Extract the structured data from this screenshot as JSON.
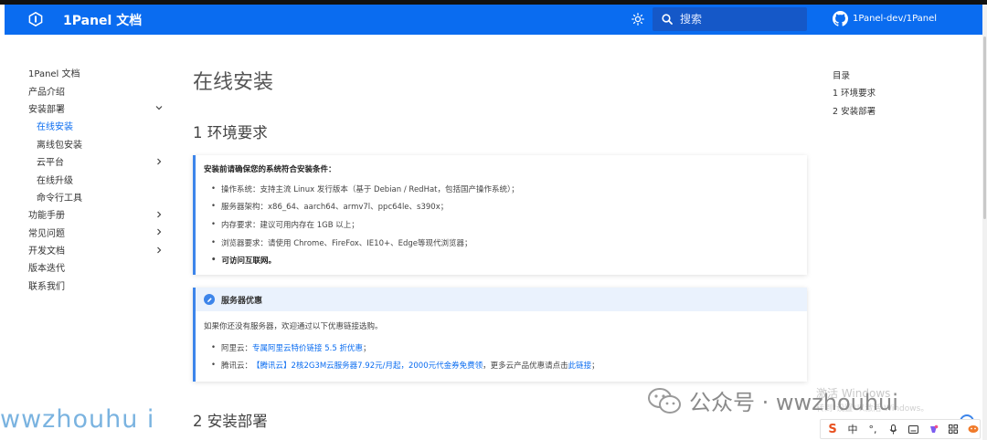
{
  "header": {
    "brand": "1Panel 文档",
    "search_placeholder": "搜索",
    "github_label": "1Panel-dev/1Panel",
    "accent": "#0a6cf0"
  },
  "sidebar": {
    "items": [
      {
        "label": "1Panel 文档",
        "chevron": ""
      },
      {
        "label": "产品介绍",
        "chevron": ""
      },
      {
        "label": "安装部署",
        "chevron": "down"
      },
      {
        "label": "在线安装",
        "sub": true,
        "active": true
      },
      {
        "label": "离线包安装",
        "sub": true
      },
      {
        "label": "云平台",
        "sub": true,
        "chevron": "right"
      },
      {
        "label": "在线升级",
        "sub": true
      },
      {
        "label": "命令行工具",
        "sub": true
      },
      {
        "label": "功能手册",
        "chevron": "right"
      },
      {
        "label": "常见问题",
        "chevron": "right"
      },
      {
        "label": "开发文档",
        "chevron": "right"
      },
      {
        "label": "版本迭代",
        "chevron": ""
      },
      {
        "label": "联系我们",
        "chevron": ""
      }
    ]
  },
  "main": {
    "title": "在线安装",
    "section1": "1 环境要求",
    "requirements": {
      "title": "安装前请确保您的系统符合安装条件：",
      "items": [
        "操作系统：支持主流 Linux 发行版本（基于 Debian / RedHat，包括国产操作系统）；",
        "服务器架构：x86_64、aarch64、armv7l、ppc64le、s390x；",
        "内存要求：建议可用内存在 1GB 以上；",
        "浏览器要求：请使用 Chrome、FireFox、IE10+、Edge等现代浏览器；",
        "可访问互联网。"
      ]
    },
    "promo": {
      "title": "服务器优惠",
      "intro": "如果你还没有服务器，欢迎通过以下优惠链接选购。",
      "aliyun_prefix": "阿里云：",
      "aliyun_link": "专属阿里云特价链接 5.5 折优惠",
      "aliyun_suffix": "；",
      "tencent_prefix": "腾讯云：",
      "tencent_link": "【腾讯云】2核2G3M云服务器7.92元/月起，2000元代金券免费领",
      "tencent_mid": "，更多云产品优惠请点击",
      "tencent_link2": "此链接",
      "tencent_suffix": "；"
    },
    "section2": "2 安装部署"
  },
  "toc": {
    "title": "目录",
    "items": [
      "1 环境要求",
      "2 安装部署"
    ]
  },
  "overlay": {
    "watermark_left": "wwzhouhu i",
    "watermark_wx": "公众号 · wwzhouhui",
    "win_activate": "激活 Windows",
    "win_activate_sub": "转到\"设置\"以激活 Windows。",
    "ime_lang": "中"
  }
}
